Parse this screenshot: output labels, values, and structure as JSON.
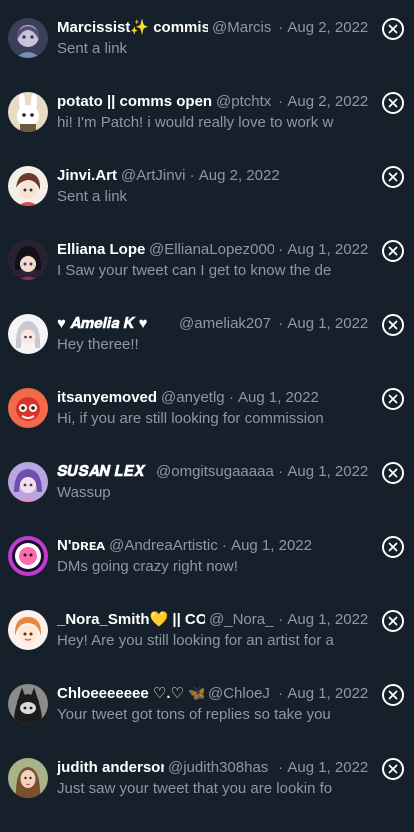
{
  "conversations": [
    {
      "name": "Marcissist✨ commis",
      "handle": "@Marcis",
      "sep": "·",
      "date": "Aug 2, 2022",
      "preview": "Sent a link",
      "avatar": "avatar-marcissist"
    },
    {
      "name": "potato || comms open",
      "handle": "@ptchtx",
      "sep": "·",
      "date": "Aug 2, 2022",
      "preview": "hi! I'm Patch! i would really love to work w",
      "avatar": "avatar-potato"
    },
    {
      "name": "Jinvi.Art",
      "handle": "@ArtJinvi",
      "sep": "·",
      "date": "Aug 2, 2022",
      "preview": "Sent a link",
      "avatar": "avatar-jinvi"
    },
    {
      "name": "Elliana Lopez",
      "handle": "@EllianaLopez000",
      "sep": "·",
      "date": "Aug 1, 2022",
      "preview": "I Saw your tweet can I get to know the de",
      "avatar": "avatar-elliana"
    },
    {
      "name": "♥ 𝑨𝒎𝒆𝒍𝒊𝒂 𝑲 ♥",
      "handle": "@ameliak207",
      "sep": "·",
      "date": "Aug 1, 2022",
      "preview": "Hey theree!!",
      "avatar": "avatar-amelia"
    },
    {
      "name": "itsanyemoved",
      "handle": "@anyetlg",
      "sep": "·",
      "date": "Aug 1, 2022",
      "preview": "Hi, if you are still looking for commission",
      "avatar": "avatar-itsanye"
    },
    {
      "name": "𝑺𝑼𝑺𝑨𝑵 𝑳𝑬𝑿",
      "handle": "@omgitsugaaaaa",
      "sep": "·",
      "date": "Aug 1, 2022",
      "preview": "Wassup",
      "avatar": "avatar-susan"
    },
    {
      "name": "N'ᴅʀᴇᴀ",
      "handle": "@AndreaArtistic",
      "sep": "·",
      "date": "Aug 1, 2022",
      "preview": "DMs going crazy right now!",
      "avatar": "avatar-ndrea"
    },
    {
      "name": "_Nora_Smith💛 || COI",
      "handle": "@_Nora_S",
      "sep": "·",
      "date": "Aug 1, 2022",
      "preview": "Hey! Are you still looking for an artist for a",
      "avatar": "avatar-nora"
    },
    {
      "name": "Chloeeeeeee ♡.♡ 🦋",
      "handle": "@ChloeJ",
      "sep": "·",
      "date": "Aug 1, 2022",
      "preview": "Your tweet got tons of replies so take you",
      "avatar": "avatar-chloe"
    },
    {
      "name": "judith anderson",
      "handle": "@judith308has",
      "sep": "·",
      "date": "Aug 1, 2022",
      "preview": "Just saw your tweet that you are lookin fo",
      "avatar": "avatar-judith"
    }
  ],
  "close_icon": "close-circle-icon",
  "colors": {
    "background": "#15202b",
    "name": "#ffffff",
    "secondary": "#8b98a5"
  }
}
